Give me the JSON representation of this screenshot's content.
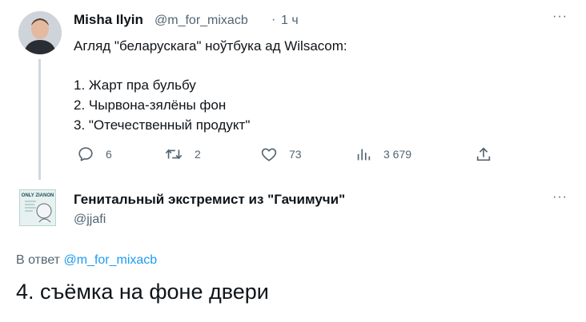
{
  "tweet": {
    "author_name": "Misha Ilyin",
    "handle": "@m_for_mixacb",
    "separator": "·",
    "time": "1 ч",
    "more": "···",
    "lines": [
      "Агляд \"беларускага\" ноўтбука ад Wilsacom:",
      "1. Жарт пра бульбу",
      "2. Чырвона-зялёны фон",
      "3. \"Отечественный продукт\""
    ],
    "actions": {
      "replies": "6",
      "retweets": "2",
      "likes": "73",
      "views": "3 679"
    }
  },
  "reply": {
    "author_name": "Генитальный экстремист из \"Гачимучи\"",
    "handle": "@jjafi",
    "more": "···",
    "avatar_caption": "ONLY ZIANON",
    "reply_prefix": "В ответ",
    "reply_to": "@m_for_mixacb",
    "text": "4. съёмка на фоне двери"
  },
  "colors": {
    "text": "#0f1419",
    "secondary": "#536471",
    "accent": "#1d9bf0",
    "thread_line": "#cfd9de"
  }
}
